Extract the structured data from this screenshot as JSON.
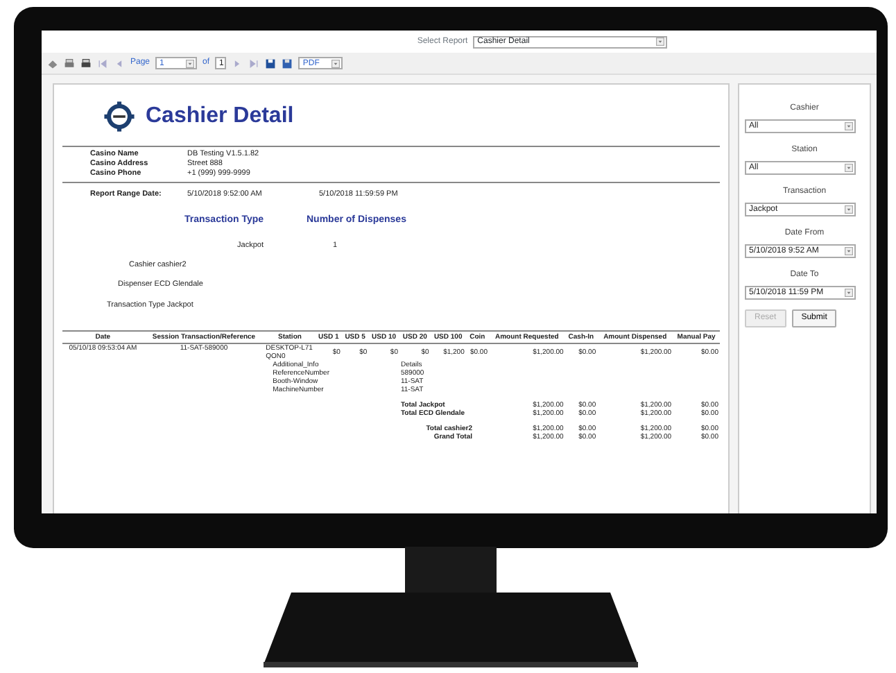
{
  "report_selector": {
    "label": "Select Report",
    "value": "Cashier Detail"
  },
  "toolbar": {
    "page_label": "Page",
    "page": "1",
    "of_label": "of",
    "page_count": "1",
    "export_format": "PDF"
  },
  "report": {
    "title": "Cashier Detail",
    "info": [
      {
        "label": "Casino Name",
        "value": "DB Testing V1.5.1.82"
      },
      {
        "label": "Casino Address",
        "value": "Street 888"
      },
      {
        "label": "Casino Phone",
        "value": "+1 (999) 999-9999"
      }
    ],
    "range": {
      "label": "Report Range Date:",
      "from": "5/10/2018 9:52:00 AM",
      "to": "5/10/2018 11:59:59 PM"
    },
    "summary": {
      "columns": [
        "Transaction Type",
        "Number of Dispenses"
      ],
      "rows": [
        [
          "Jackpot",
          "1"
        ]
      ]
    },
    "groups": [
      "Cashier cashier2",
      "Dispenser ECD Glendale",
      "Transaction Type Jackpot"
    ],
    "table": {
      "columns": [
        "Date",
        "Session Transaction/Reference",
        "Station",
        "USD 1",
        "USD 5",
        "USD 10",
        "USD 20",
        "USD 100",
        "Coin",
        "Amount Requested",
        "Cash-In",
        "Amount Dispensed",
        "Manual Pay"
      ],
      "rows": [
        [
          "05/10/18 09:53:04 AM",
          "11-SAT-589000",
          "DESKTOP-L71QON0",
          "$0",
          "$0",
          "$0",
          "$0",
          "$1,200",
          "$0.00",
          "$1,200.00",
          "$0.00",
          "$1,200.00",
          "$0.00"
        ]
      ]
    },
    "details": [
      {
        "key": "Additional_Info",
        "value": "Details"
      },
      {
        "key": "ReferenceNumber",
        "value": "589000"
      },
      {
        "key": "Booth-Window",
        "value": "11-SAT"
      },
      {
        "key": "MachineNumber",
        "value": "11-SAT"
      }
    ],
    "totals": [
      {
        "kind": "subtotal",
        "label": "Total Jackpot",
        "values": [
          "$1,200.00",
          "$0.00",
          "$1,200.00",
          "$0.00"
        ]
      },
      {
        "kind": "subtotal",
        "label": "Total ECD Glendale",
        "values": [
          "$1,200.00",
          "$0.00",
          "$1,200.00",
          "$0.00"
        ]
      },
      {
        "kind": "total",
        "label": "Total cashier2",
        "values": [
          "$1,200.00",
          "$0.00",
          "$1,200.00",
          "$0.00"
        ]
      },
      {
        "kind": "total",
        "label": "Grand Total",
        "values": [
          "$1,200.00",
          "$0.00",
          "$1,200.00",
          "$0.00"
        ]
      }
    ]
  },
  "filters": [
    {
      "label": "Cashier",
      "value": "All"
    },
    {
      "label": "Station",
      "value": "All"
    },
    {
      "label": "Transaction",
      "value": "Jackpot"
    },
    {
      "label": "Date From",
      "value": "5/10/2018 9:52 AM"
    },
    {
      "label": "Date To",
      "value": "5/10/2018 11:59 PM"
    }
  ],
  "buttons": [
    {
      "label": "Reset",
      "disabled": true
    },
    {
      "label": "Submit",
      "disabled": false
    }
  ]
}
